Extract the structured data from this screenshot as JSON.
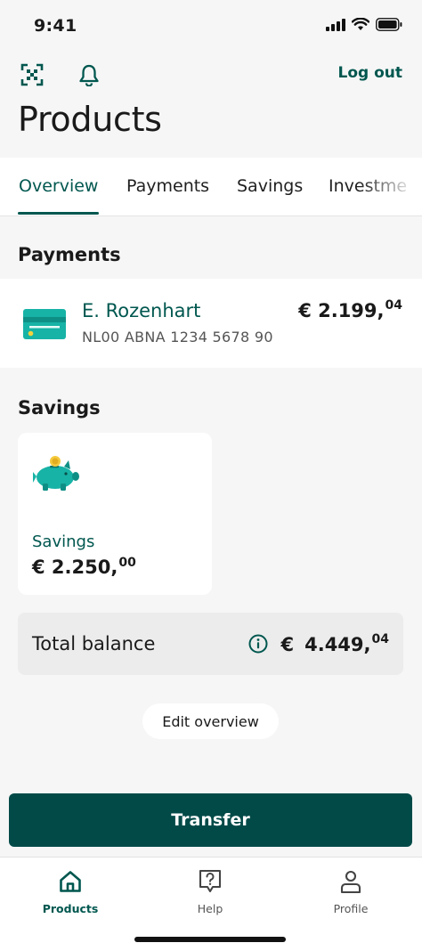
{
  "status_bar": {
    "time": "9:41"
  },
  "header": {
    "logout_label": "Log out",
    "title": "Products"
  },
  "tabs": [
    {
      "label": "Overview",
      "active": true
    },
    {
      "label": "Payments",
      "active": false
    },
    {
      "label": "Savings",
      "active": false
    },
    {
      "label": "Investme",
      "active": false
    }
  ],
  "payments": {
    "section_title": "Payments",
    "account": {
      "name": "E. Rozenhart",
      "iban": "NL00 ABNA 1234 5678 90",
      "amount_main": "€ 2.199,",
      "amount_cents": "04"
    }
  },
  "savings": {
    "section_title": "Savings",
    "tile": {
      "label": "Savings",
      "amount_main": "€ 2.250,",
      "amount_cents": "00"
    }
  },
  "total": {
    "label": "Total balance",
    "currency": "€",
    "amount_main": "4.449,",
    "amount_cents": "04"
  },
  "edit_overview_label": "Edit overview",
  "transfer_label": "Transfer",
  "bottom_nav": [
    {
      "label": "Products",
      "icon": "home-icon",
      "active": true
    },
    {
      "label": "Help",
      "icon": "help-icon",
      "active": false
    },
    {
      "label": "Profile",
      "icon": "profile-icon",
      "active": false
    }
  ],
  "colors": {
    "brand": "#00574f",
    "button": "#014a48",
    "background": "#f6f6f6",
    "card_teal": "#17b3a6"
  }
}
